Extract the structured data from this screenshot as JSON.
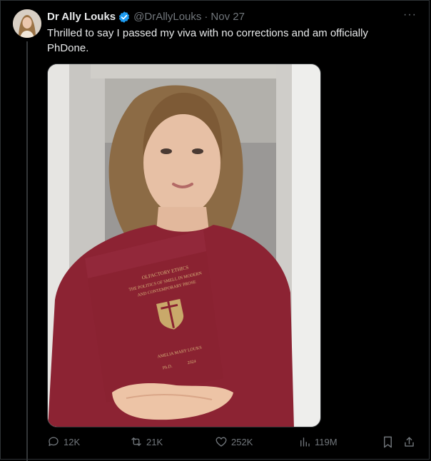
{
  "tweet": {
    "author_name": "Dr Ally Louks",
    "handle": "@DrAllyLouks",
    "separator": "·",
    "date": "Nov 27",
    "more_label": "···",
    "text": "Thrilled to say I passed my viva with no corrections and am officially PhDone."
  },
  "thesis": {
    "title_line1": "OLFACTORY ETHICS",
    "title_line2": "THE POLITICS OF SMELL IN MODERN",
    "title_line3": "AND CONTEMPORARY PROSE",
    "author": "AMELIA MARY LOUKS",
    "degree": "Ph.D.",
    "year": "2024"
  },
  "actions": {
    "replies": "12K",
    "reposts": "21K",
    "likes": "252K",
    "views": "119M"
  },
  "colors": {
    "background": "#000000",
    "text": "#e7e9ea",
    "muted": "#71767b",
    "verified": "#1d9bf0",
    "thesis_cover": "#8a2231"
  }
}
